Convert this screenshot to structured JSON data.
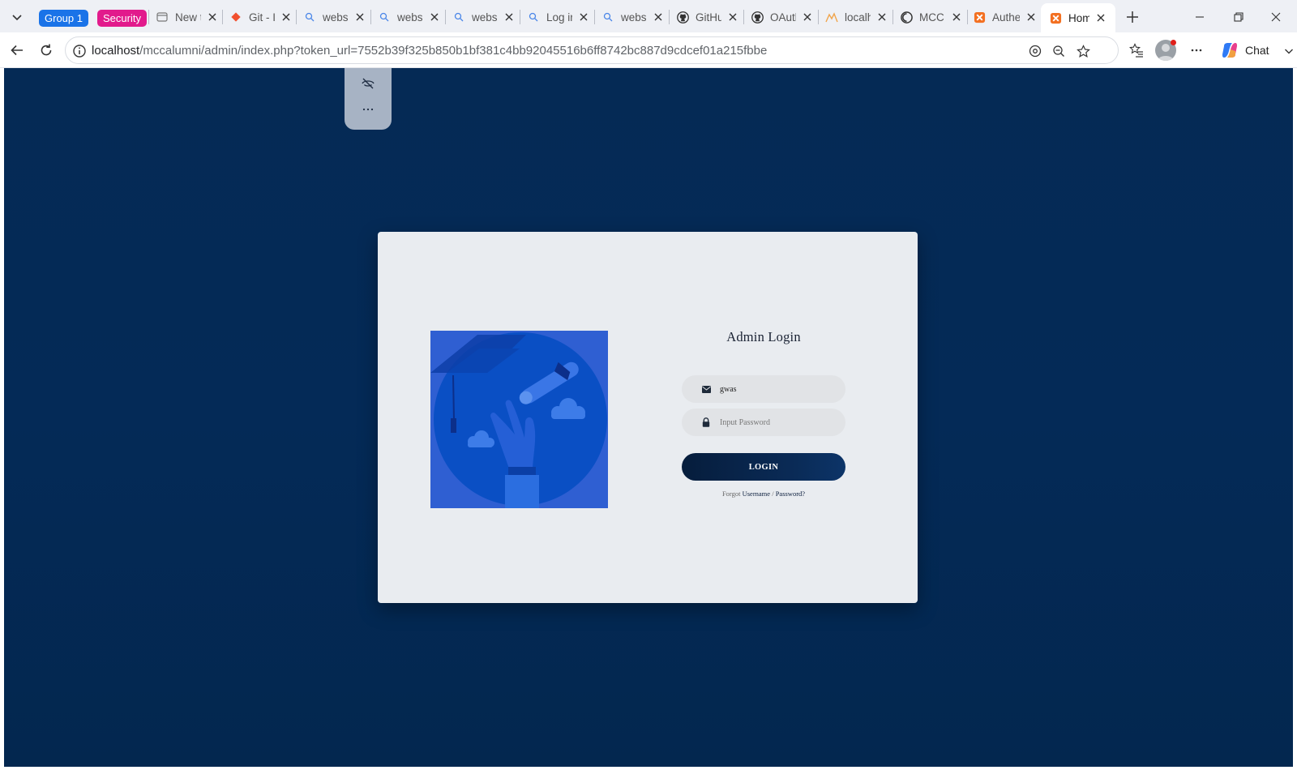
{
  "browser": {
    "tab_groups": [
      {
        "label": "Group 1",
        "color": "#1a73e8"
      },
      {
        "label": "Security",
        "color": "#e21a8c"
      }
    ],
    "tabs": [
      {
        "title": "New t",
        "icon": "new-tab-page-icon"
      },
      {
        "title": "Git - I",
        "icon": "git-icon"
      },
      {
        "title": "websi",
        "icon": "search-icon"
      },
      {
        "title": "websi",
        "icon": "search-icon"
      },
      {
        "title": "websi",
        "icon": "search-icon"
      },
      {
        "title": "Log ir",
        "icon": "search-icon"
      },
      {
        "title": "websi",
        "icon": "search-icon"
      },
      {
        "title": "GitHu",
        "icon": "github-icon"
      },
      {
        "title": "OAutl",
        "icon": "github-icon"
      },
      {
        "title": "localh",
        "icon": "xampp-icon"
      },
      {
        "title": "MCC /",
        "icon": "site-icon"
      },
      {
        "title": "Authe",
        "icon": "xampp-icon"
      },
      {
        "title": "Home",
        "icon": "xampp-icon",
        "active": true
      }
    ],
    "address": {
      "host": "localhost",
      "path": "/mccalumni/admin/index.php?token_url=7552b39f325b850b1bf381c4bb92045516b6ff8742bc887d9cdcef01a215fbbe"
    },
    "chat_label": "Chat"
  },
  "page": {
    "floating_tools": [
      "hide-eye-icon",
      "more-icon"
    ],
    "login": {
      "title": "Admin Login",
      "username_value": "gwas",
      "password_placeholder": "Input Password",
      "button_label": "LOGIN",
      "forgot_prefix": "Forgot",
      "forgot_username": "Username",
      "forgot_sep": "/",
      "forgot_password": "Password?"
    },
    "colors": {
      "background": "#042a57",
      "card": "#e9ecf0",
      "button": "#061d3c",
      "illustration": "#2f5fd2"
    }
  }
}
